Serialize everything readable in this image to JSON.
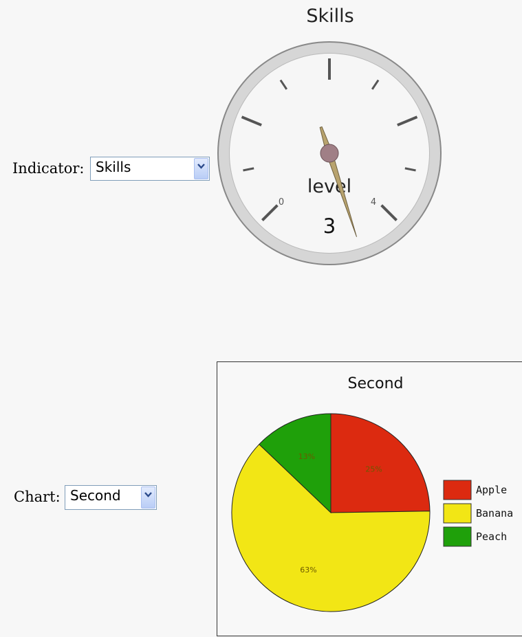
{
  "indicator": {
    "label": "Indicator:",
    "selected": "Skills"
  },
  "gauge": {
    "title": "Skills",
    "label": "level",
    "value": 3,
    "value_text": "3",
    "min": 0,
    "max": 4,
    "min_text": "0",
    "max_text": "4",
    "needle_value": 4.4,
    "colors": {
      "needle": "#b8a36e",
      "hub": "#a07f86",
      "rim": "#d4d4d4",
      "face": "#f6f6f6"
    }
  },
  "chart_selector": {
    "label": "Chart:",
    "selected": "Second"
  },
  "chart_data": {
    "type": "pie",
    "title": "Second",
    "categories": [
      "Apple",
      "Banana",
      "Peach"
    ],
    "values": [
      25,
      63,
      13
    ],
    "labels": [
      "25%",
      "63%",
      "13%"
    ],
    "colors": [
      "#dc2a10",
      "#f2e615",
      "#1fa00a"
    ],
    "legend": "right"
  },
  "icons": {
    "dropdown": "chevron-down-icon"
  }
}
